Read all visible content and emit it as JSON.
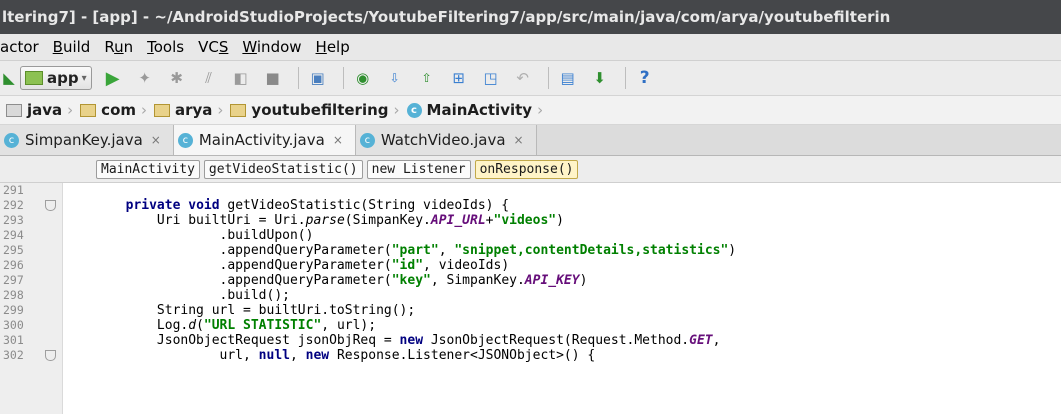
{
  "window": {
    "title": "ltering7] - [app] - ~/AndroidStudioProjects/YoutubeFiltering7/app/src/main/java/com/arya/youtubefilterin"
  },
  "menu": {
    "items": [
      {
        "label": "actor",
        "mnemonic": ""
      },
      {
        "label": "Build",
        "mnemonic": "B"
      },
      {
        "label": "Run",
        "mnemonic": "u"
      },
      {
        "label": "Tools",
        "mnemonic": "T"
      },
      {
        "label": "VCS",
        "mnemonic": "S"
      },
      {
        "label": "Window",
        "mnemonic": "W"
      },
      {
        "label": "Help",
        "mnemonic": "H"
      }
    ]
  },
  "toolbar": {
    "run_config": "app",
    "icons": [
      "run-icon",
      "debug-icon",
      "attach-debugger-icon",
      "profile-icon",
      "apply-changes-icon",
      "stop-icon",
      "avd-manager-icon",
      "sync-icon",
      "vcs-update-icon",
      "vcs-commit-icon",
      "vcs-compare-icon",
      "history-icon",
      "revert-icon",
      "terminal-icon",
      "sdk-manager-icon",
      "help-icon"
    ],
    "colors": {
      "run": "#3aa53a",
      "stop": "#8a8a8a",
      "help": "#2f6fc4",
      "accent_orange": "#d78a1f"
    }
  },
  "breadcrumbs": [
    "java",
    "com",
    "arya",
    "youtubefiltering",
    "MainActivity"
  ],
  "tabs": [
    {
      "label": "SimpanKey.java",
      "active": false
    },
    {
      "label": "MainActivity.java",
      "active": true
    },
    {
      "label": "WatchVideo.java",
      "active": false
    }
  ],
  "structure_bar": [
    "MainActivity",
    "getVideoStatistic()",
    "new Listener",
    "onResponse()"
  ],
  "editor": {
    "line_numbers": [
      "291",
      "292",
      "293",
      "294",
      "295",
      "296",
      "297",
      "298",
      "299",
      "300",
      "301",
      "302"
    ],
    "lines": [
      [
        {
          "t": "            "
        }
      ],
      [
        {
          "t": "        "
        },
        {
          "t": "private void",
          "c": "kw"
        },
        {
          "t": " getVideoStatistic(String videoIds) {"
        }
      ],
      [
        {
          "t": "            Uri builtUri = Uri."
        },
        {
          "t": "parse",
          "c": "ital"
        },
        {
          "t": "(SimpanKey."
        },
        {
          "t": "API_URL",
          "c": "const"
        },
        {
          "t": "+"
        },
        {
          "t": "\"videos\"",
          "c": "str"
        },
        {
          "t": ")"
        }
      ],
      [
        {
          "t": "                    .buildUpon()"
        }
      ],
      [
        {
          "t": "                    .appendQueryParameter("
        },
        {
          "t": "\"part\"",
          "c": "str"
        },
        {
          "t": ", "
        },
        {
          "t": "\"snippet,contentDetails,statistics\"",
          "c": "str"
        },
        {
          "t": ")"
        }
      ],
      [
        {
          "t": "                    .appendQueryParameter("
        },
        {
          "t": "\"id\"",
          "c": "str"
        },
        {
          "t": ", videoIds)"
        }
      ],
      [
        {
          "t": "                    .appendQueryParameter("
        },
        {
          "t": "\"key\"",
          "c": "str"
        },
        {
          "t": ", SimpanKey."
        },
        {
          "t": "API_KEY",
          "c": "const"
        },
        {
          "t": ")"
        }
      ],
      [
        {
          "t": "                    .build();"
        }
      ],
      [
        {
          "t": "            String url = builtUri.toString();"
        }
      ],
      [
        {
          "t": "            Log."
        },
        {
          "t": "d",
          "c": "ital"
        },
        {
          "t": "("
        },
        {
          "t": "\"URL STATISTIC\"",
          "c": "str"
        },
        {
          "t": ", url);"
        }
      ],
      [
        {
          "t": "            JsonObjectRequest jsonObjReq = "
        },
        {
          "t": "new",
          "c": "kw"
        },
        {
          "t": " JsonObjectRequest(Request.Method."
        },
        {
          "t": "GET",
          "c": "const"
        },
        {
          "t": ","
        }
      ],
      [
        {
          "t": "                    url, "
        },
        {
          "t": "null",
          "c": "kw"
        },
        {
          "t": ", "
        },
        {
          "t": "new",
          "c": "kw"
        },
        {
          "t": " Response.Listener<JSONObject>() {"
        }
      ]
    ],
    "fold_lines": [
      "292",
      "302"
    ]
  }
}
